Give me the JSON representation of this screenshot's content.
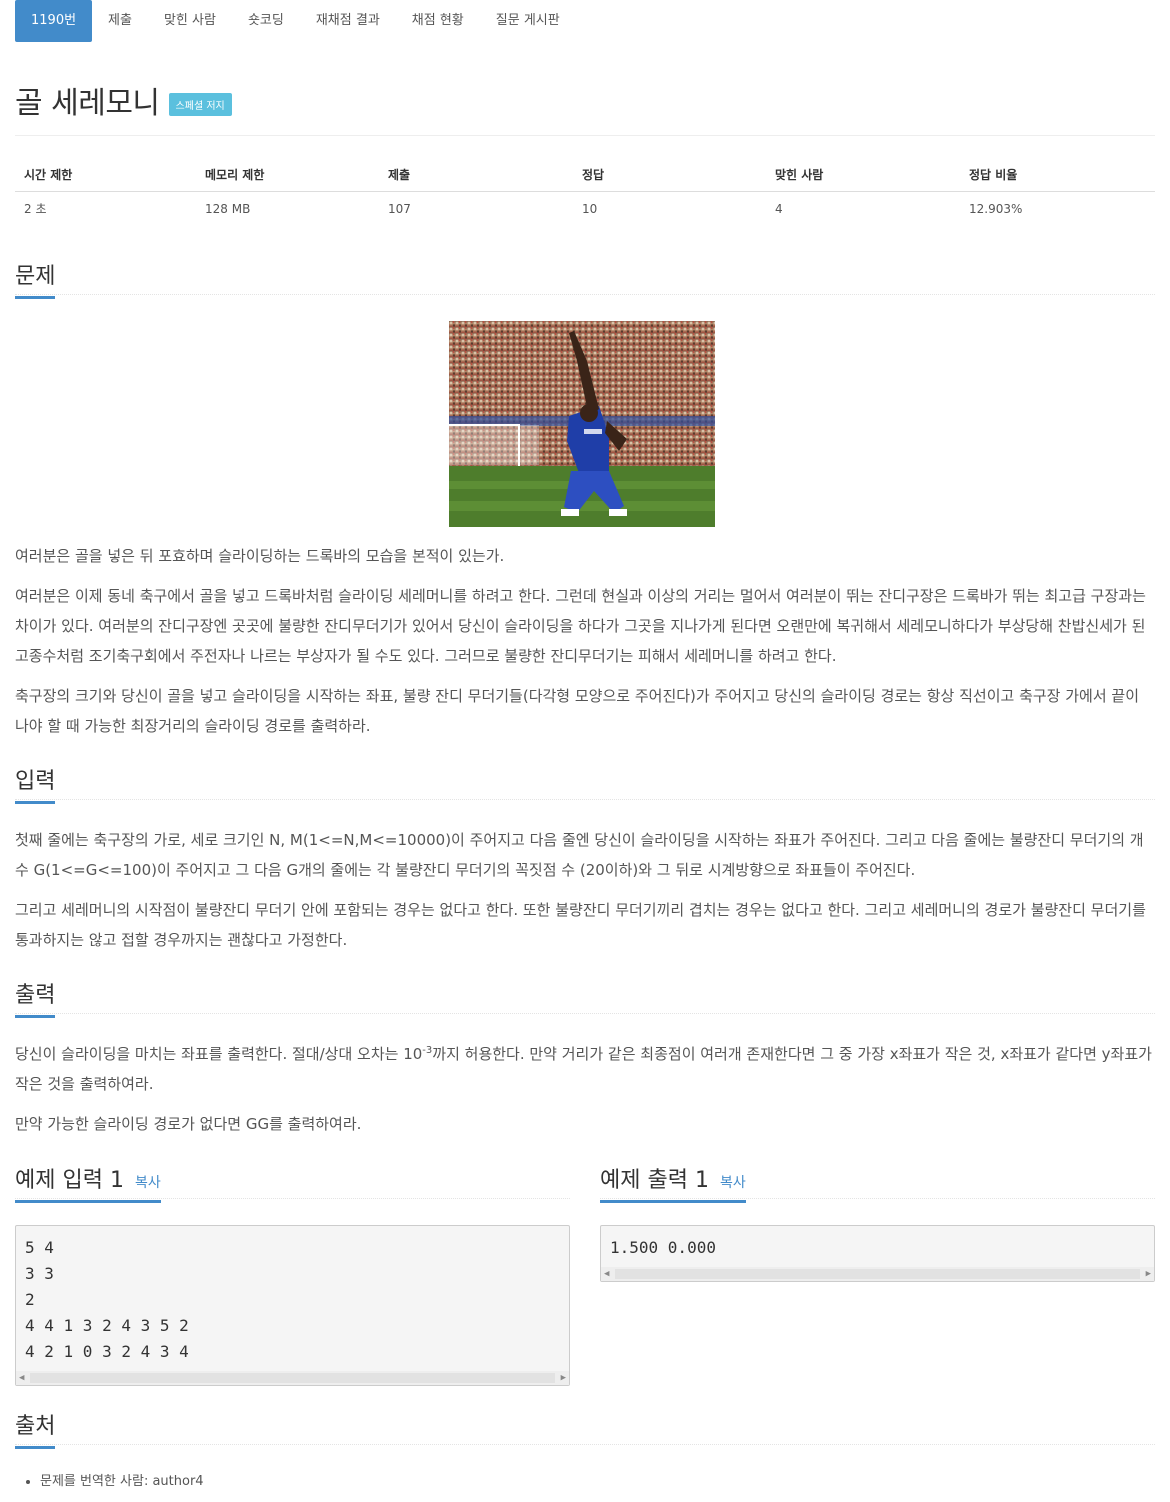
{
  "tabs": [
    {
      "label": "1190번",
      "active": true
    },
    {
      "label": "제출"
    },
    {
      "label": "맞힌 사람"
    },
    {
      "label": "숏코딩"
    },
    {
      "label": "재채점 결과"
    },
    {
      "label": "채점 현황"
    },
    {
      "label": "질문 게시판"
    }
  ],
  "problem": {
    "title": "골 세레모니",
    "badge": "스페셜 저지"
  },
  "info": {
    "headers": [
      "시간 제한",
      "메모리 제한",
      "제출",
      "정답",
      "맞힌 사람",
      "정답 비율"
    ],
    "values": [
      "2 초",
      "128 MB",
      "107",
      "10",
      "4",
      "12.903%"
    ]
  },
  "sections": {
    "description": "문제",
    "input": "입력",
    "output": "출력",
    "source": "출처"
  },
  "description": [
    "여러분은 골을 넣은 뒤 포효하며 슬라이딩하는 드록바의 모습을 본적이 있는가.",
    "여러분은 이제 동네 축구에서 골을 넣고 드록바처럼 슬라이딩 세레머니를 하려고 한다. 그런데 현실과 이상의 거리는 멀어서 여러분이 뛰는 잔디구장은 드록바가 뛰는 최고급 구장과는 차이가 있다. 여러분의 잔디구장엔 곳곳에 불량한 잔디무더기가 있어서 당신이 슬라이딩을 하다가 그곳을 지나가게 된다면 오랜만에 복귀해서 세레모니하다가 부상당해 찬밥신세가 된 고종수처럼 조기축구회에서 주전자나 나르는 부상자가 될 수도 있다. 그러므로 불량한 잔디무더기는 피해서 세레머니를 하려고 한다.",
    "축구장의 크기와 당신이 골을 넣고 슬라이딩을 시작하는 좌표,  불량 잔디 무더기들(다각형 모양으로 주어진다)가 주어지고 당신의 슬라이딩 경로는 항상 직선이고 축구장 가에서 끝이 나야 할 때 가능한 최장거리의 슬라이딩 경로를 출력하라."
  ],
  "input": [
    "첫째 줄에는 축구장의 가로, 세로 크기인 N, M(1<=N,M<=10000)이 주어지고 다음 줄엔 당신이 슬라이딩을 시작하는 좌표가 주어진다. 그리고 다음 줄에는 불량잔디 무더기의 개수 G(1<=G<=100)이 주어지고 그 다음 G개의 줄에는 각 불량잔디 무더기의 꼭짓점 수 (20이하)와 그 뒤로 시계방향으로 좌표들이 주어진다.",
    "그리고 세레머니의 시작점이 불량잔디 무더기 안에 포함되는 경우는 없다고 한다. 또한 불량잔디 무더기끼리 겹치는 경우는 없다고 한다. 그리고 세레머니의 경로가 불량잔디 무더기를 통과하지는 않고 접할 경우까지는 괜찮다고 가정한다."
  ],
  "output": {
    "p1_before": "당신이 슬라이딩을 마치는 좌표를 출력한다. 절대/상대 오차는 10",
    "p1_sup": "-3",
    "p1_after": "까지 허용한다. 만약 거리가 같은 최종점이 여러개 존재한다면 그 중 가장 x좌표가 작은 것, x좌표가 같다면 y좌표가 작은 것을 출력하여라.",
    "p2": "만약 가능한 슬라이딩 경로가 없다면 GG를 출력하여라."
  },
  "sample_input": {
    "title": "예제 입력 1",
    "copy": "복사",
    "lines": [
      "5 4",
      "3 3",
      "2",
      "4 4 1 3 2 4 3 5 2",
      "4 2 1 0 3 2 4 3 4"
    ]
  },
  "sample_output": {
    "title": "예제 출력 1",
    "copy": "복사",
    "lines": [
      "1.500 0.000"
    ]
  },
  "source": {
    "items": [
      "문제를 번역한 사람: author4"
    ]
  }
}
